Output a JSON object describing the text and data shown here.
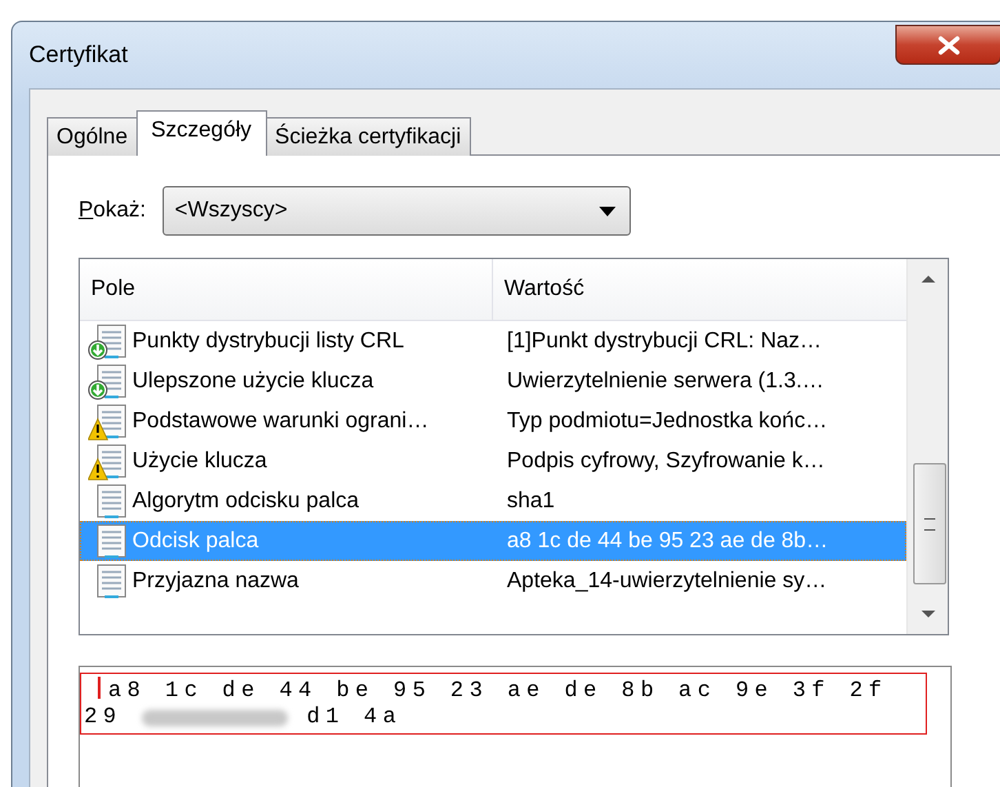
{
  "window": {
    "title": "Certyfikat"
  },
  "tabs": [
    {
      "label": "Ogólne",
      "selected": false
    },
    {
      "label": "Szczegóły",
      "selected": true
    },
    {
      "label": "Ścieżka certyfikacji",
      "selected": false
    }
  ],
  "show": {
    "label_underlined": "P",
    "label_rest": "okaż:",
    "value": "<Wszyscy>"
  },
  "table": {
    "columns": [
      "Pole",
      "Wartość"
    ],
    "rows": [
      {
        "kind": "download",
        "field": "Punkty dystrybucji listy CRL",
        "value": "[1]Punkt dystrybucji CRL: Naz…",
        "selected": false
      },
      {
        "kind": "download",
        "field": "Ulepszone użycie klucza",
        "value": "Uwierzytelnienie serwera (1.3.…",
        "selected": false
      },
      {
        "kind": "warning",
        "field": "Podstawowe warunki ograni…",
        "value": "Typ podmiotu=Jednostka końc…",
        "selected": false
      },
      {
        "kind": "warning",
        "field": "Użycie klucza",
        "value": "Podpis cyfrowy, Szyfrowanie k…",
        "selected": false
      },
      {
        "kind": "plain",
        "field": "Algorytm odcisku palca",
        "value": "sha1",
        "selected": false
      },
      {
        "kind": "plain",
        "field": "Odcisk palca",
        "value": "a8 1c de 44 be 95 23 ae de 8b…",
        "selected": true
      },
      {
        "kind": "plain",
        "field": "Przyjazna nazwa",
        "value": "Apteka_14-uwierzytelnienie sy…",
        "selected": false
      }
    ]
  },
  "detail": {
    "line_1": "a8 1c de 44 be 95 23 ae de 8b ac 9e 3f 2f",
    "line_2_start": "29",
    "line_2_end": "d1 4a"
  }
}
